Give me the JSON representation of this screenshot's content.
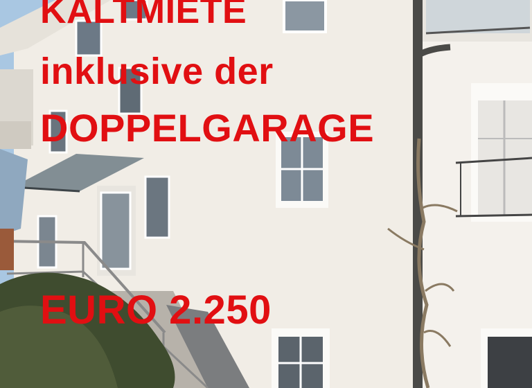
{
  "overlay": {
    "line1": "KALTMIETE",
    "line2": "inklusive der",
    "line3": "DOPPELGARAGE",
    "line4": "EURO  2.250"
  },
  "colors": {
    "text_red": "#e10f12",
    "facade": "#f1ede6",
    "sky": "#a9c7e2",
    "foliage": "#3f4c2f",
    "gutter": "#4a4a47"
  },
  "photo_elements": [
    "house-facade",
    "glass-canopy",
    "entrance-door",
    "stairway-railing",
    "downpipe",
    "bare-vine",
    "hedge",
    "windows"
  ]
}
